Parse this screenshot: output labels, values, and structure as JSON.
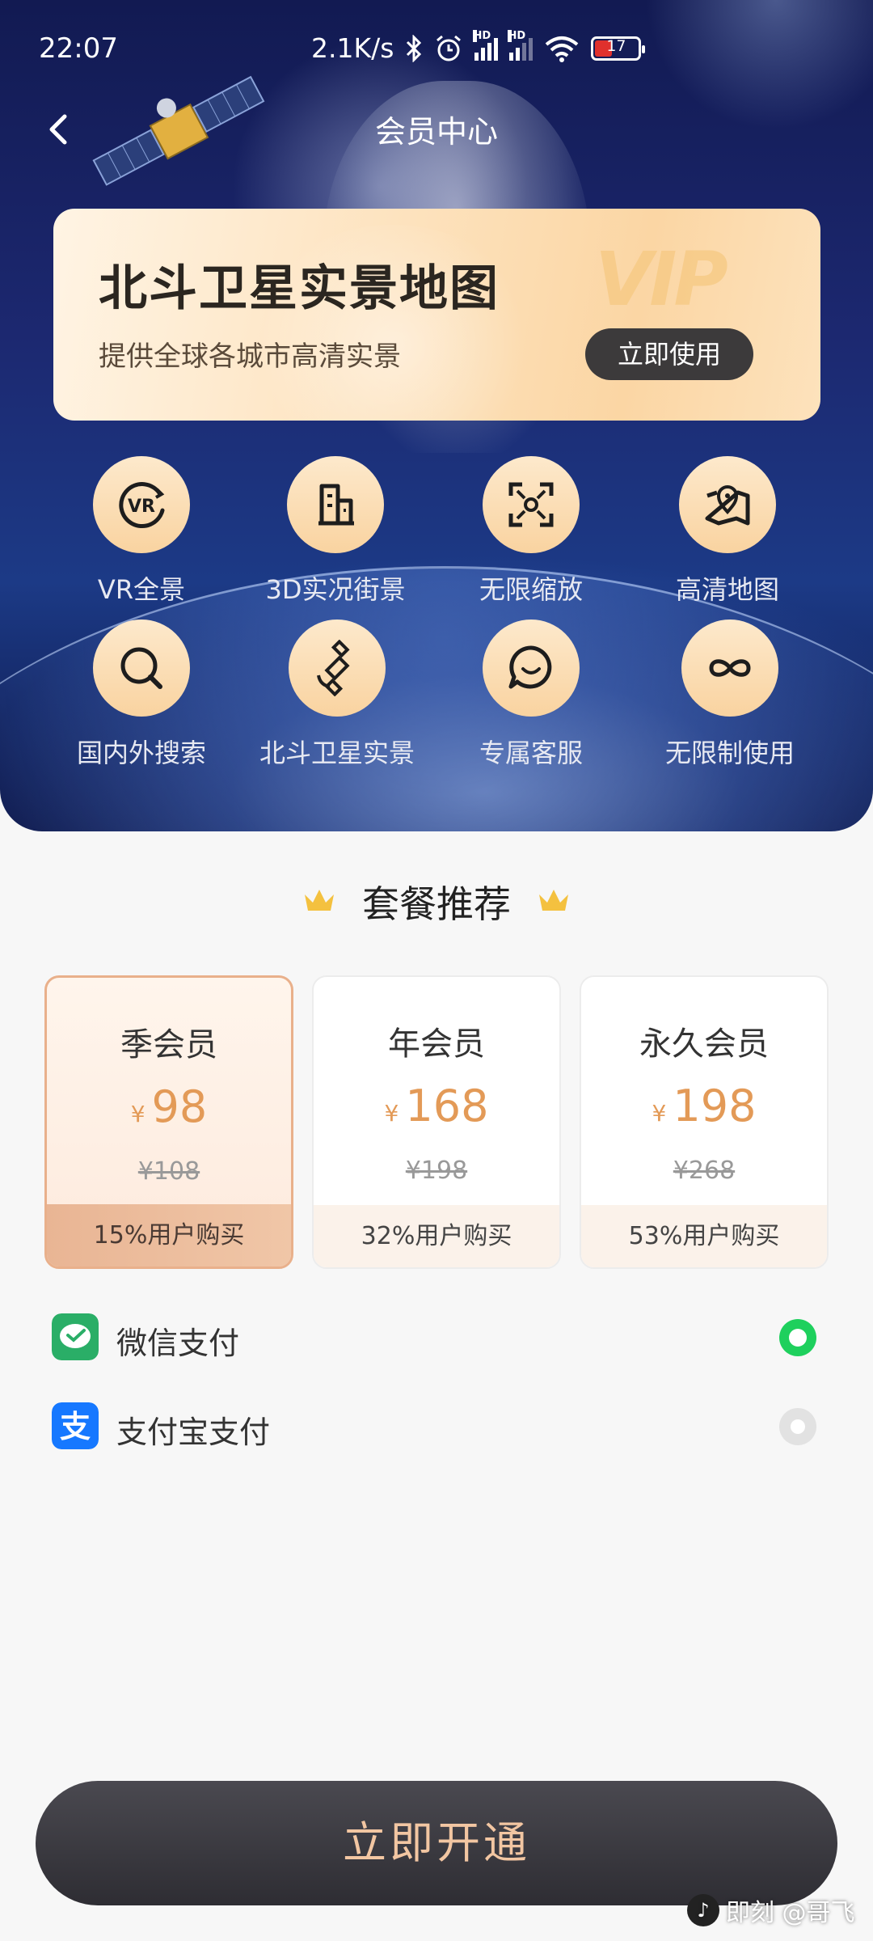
{
  "status_bar": {
    "time": "22:07",
    "speed": "2.1K/s",
    "battery": "17"
  },
  "header": {
    "title": "会员中心"
  },
  "banner": {
    "title": "北斗卫星实景地图",
    "subtitle": "提供全球各城市高清实景",
    "vip_text": "VIP",
    "button": "立即使用"
  },
  "features": [
    {
      "label": "VR全景",
      "icon": "vr-icon"
    },
    {
      "label": "3D实况街景",
      "icon": "building-icon"
    },
    {
      "label": "无限缩放",
      "icon": "zoom-focus-icon"
    },
    {
      "label": "高清地图",
      "icon": "map-pin-icon"
    },
    {
      "label": "国内外搜索",
      "icon": "search-icon"
    },
    {
      "label": "北斗卫星实景",
      "icon": "satellite-icon"
    },
    {
      "label": "专属客服",
      "icon": "chat-icon"
    },
    {
      "label": "无限制使用",
      "icon": "infinity-icon"
    }
  ],
  "packages": {
    "heading": "套餐推荐",
    "items": [
      {
        "name": "季会员",
        "currency": "¥",
        "price": "98",
        "original": "¥108",
        "buyers": "15%用户购买",
        "selected": true
      },
      {
        "name": "年会员",
        "currency": "¥",
        "price": "168",
        "original": "¥198",
        "buyers": "32%用户购买",
        "selected": false
      },
      {
        "name": "永久会员",
        "currency": "¥",
        "price": "198",
        "original": "¥268",
        "buyers": "53%用户购买",
        "selected": false
      }
    ]
  },
  "payment": {
    "options": [
      {
        "label": "微信支付",
        "selected": true,
        "color": "#2aae67"
      },
      {
        "label": "支付宝支付",
        "selected": false,
        "color": "#1678ff"
      }
    ]
  },
  "cta": {
    "label": "立即开通"
  },
  "watermark": {
    "text": "即刻 @哥飞"
  },
  "colors": {
    "accent_price": "#e39a57",
    "wechat_green": "#1ed05d",
    "cta_text": "#f2c6a2"
  }
}
